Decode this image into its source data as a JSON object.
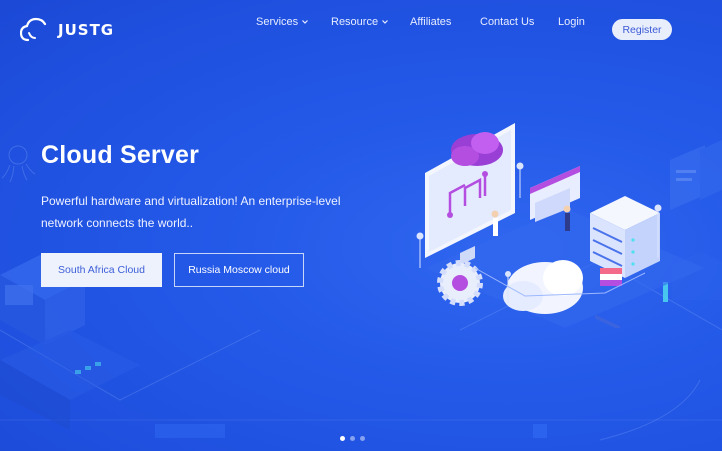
{
  "brand": {
    "logo_text": "JUSTG"
  },
  "nav": {
    "items": [
      {
        "label": "Services",
        "has_dropdown": true
      },
      {
        "label": "Resource",
        "has_dropdown": true
      },
      {
        "label": "Affiliates",
        "has_dropdown": false
      },
      {
        "label": "Contact Us",
        "has_dropdown": false
      },
      {
        "label": "Login",
        "has_dropdown": false
      }
    ],
    "register_label": "Register"
  },
  "hero": {
    "title": "Cloud Server",
    "description": "Powerful hardware and virtualization! An enterprise-level network connects the world..",
    "primary_button": "South Africa Cloud",
    "secondary_button": "Russia Moscow cloud"
  },
  "carousel": {
    "slide_count": 3,
    "active_index": 0
  },
  "colors": {
    "background": "#2157e6",
    "primary_button_bg": "#eef2fd",
    "primary_button_text": "#3d5fd8",
    "accent_purple": "#b34ee0",
    "accent_cyan": "#4fe0f0"
  },
  "icons": [
    "cloud-logo-icon",
    "chevron-down-icon",
    "server-rack-icon",
    "gear-icon",
    "cloud-icon",
    "monitor-icon"
  ]
}
